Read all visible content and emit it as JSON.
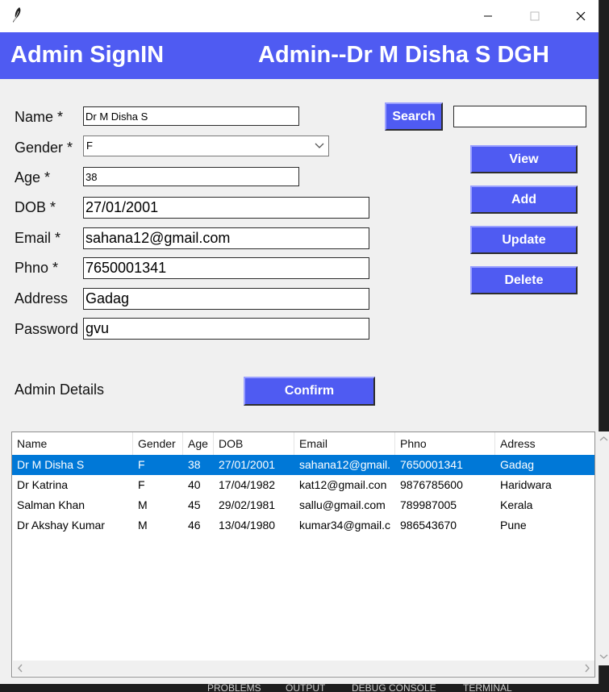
{
  "banner": {
    "left_title": "Admin SignIN",
    "right_title": "Admin--Dr M Disha S  DGH"
  },
  "form": {
    "name_label": "Name *",
    "name_value": "Dr M Disha S",
    "gender_label": "Gender *",
    "gender_value": "F",
    "age_label": "Age *",
    "age_value": "38",
    "dob_label": "DOB *",
    "dob_value": "27/01/2001",
    "email_label": "Email *",
    "email_value": "sahana12@gmail.com",
    "phno_label": "Phno *",
    "phno_value": "7650001341",
    "address_label": "Address",
    "address_value": "Gadag",
    "password_label": "Password",
    "password_value": "gvu",
    "details_label": "Admin Details"
  },
  "buttons": {
    "search": "Search",
    "view": "View",
    "add": "Add",
    "update": "Update",
    "delete": "Delete",
    "confirm": "Confirm"
  },
  "search_value": "",
  "table": {
    "columns": [
      "Name",
      "Gender",
      "Age",
      "DOB",
      "Email",
      "Phno",
      "Adress"
    ],
    "rows": [
      [
        "Dr M Disha S",
        "F",
        "38",
        "27/01/2001",
        "sahana12@gmail.",
        "7650001341",
        "Gadag"
      ],
      [
        "Dr Katrina",
        "F",
        "40",
        "17/04/1982",
        "kat12@gmail.con",
        "9876785600",
        "Haridwara"
      ],
      [
        "Salman Khan",
        "M",
        "45",
        "29/02/1981",
        "sallu@gmail.com",
        "789987005",
        "Kerala"
      ],
      [
        "Dr Akshay Kumar",
        "M",
        "46",
        "13/04/1980",
        "kumar34@gmail.c",
        "986543670",
        "Pune"
      ]
    ],
    "selected_row": 0
  },
  "background_tabs": [
    "PROBLEMS",
    "OUTPUT",
    "DEBUG CONSOLE",
    "TERMINAL"
  ],
  "colors": {
    "accent": "#4f5bf2",
    "selection": "#0078d7"
  }
}
